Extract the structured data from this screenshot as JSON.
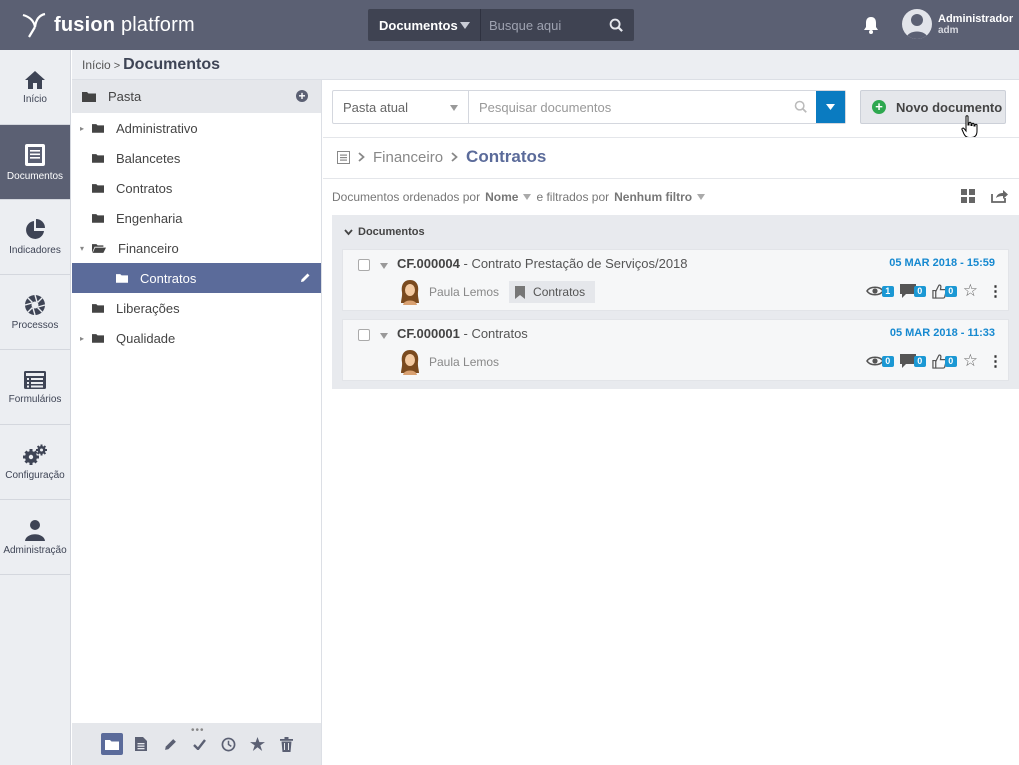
{
  "app": {
    "logo_bold": "fusion",
    "logo_rest": "platform"
  },
  "global_search": {
    "type_label": "Documentos",
    "placeholder": "Busque aqui"
  },
  "user": {
    "name": "Administrador",
    "login": "adm"
  },
  "rail": [
    {
      "label": "Início",
      "icon": "home-icon"
    },
    {
      "label": "Documentos",
      "icon": "document-icon",
      "active": true
    },
    {
      "label": "Indicadores",
      "icon": "pie-chart-icon"
    },
    {
      "label": "Processos",
      "icon": "aperture-icon"
    },
    {
      "label": "Formulários",
      "icon": "form-icon"
    },
    {
      "label": "Configuração",
      "icon": "gears-icon"
    },
    {
      "label": "Administração",
      "icon": "admin-user-icon"
    }
  ],
  "breadcrumb": {
    "home": "Início",
    "separator": ">",
    "current": "Documentos"
  },
  "folders": {
    "header": "Pasta",
    "items": [
      {
        "label": "Administrativo",
        "expandable": true
      },
      {
        "label": "Balancetes"
      },
      {
        "label": "Contratos"
      },
      {
        "label": "Engenharia"
      },
      {
        "label": "Financeiro",
        "expanded": true
      },
      {
        "label": "Contratos",
        "selected": true,
        "child": true
      },
      {
        "label": "Liberações"
      },
      {
        "label": "Qualidade",
        "expandable": true
      }
    ],
    "footer_tools": [
      "folder-icon",
      "file-icon",
      "pencil-icon",
      "check-icon",
      "clock-icon",
      "star-icon",
      "trash-icon"
    ]
  },
  "main": {
    "scope_select": "Pasta atual",
    "search_placeholder": "Pesquisar documentos",
    "new_button": "Novo documento",
    "path": {
      "parent": "Financeiro",
      "current": "Contratos"
    },
    "order": {
      "prefix": "Documentos ordenados por",
      "sort": "Nome",
      "middle": "e filtrados por",
      "filter": "Nenhum filtro"
    },
    "documents_title": "Documentos",
    "documents": [
      {
        "code": "CF.000004",
        "title": " - Contrato Prestação de Serviços/2018",
        "date": "05 MAR 2018 - 15:59",
        "author": "Paula Lemos",
        "tag": "Contratos",
        "views": "1",
        "comments": "0",
        "likes": "0"
      },
      {
        "code": "CF.000001",
        "title": " - Contratos",
        "date": "05 MAR 2018 - 11:33",
        "author": "Paula Lemos",
        "tag": "",
        "views": "0",
        "comments": "0",
        "likes": "0"
      }
    ]
  },
  "colors": {
    "topbar": "#5b6073",
    "accent": "#5b6b9a",
    "link_blue": "#1689d0",
    "success": "#2ea84f"
  }
}
